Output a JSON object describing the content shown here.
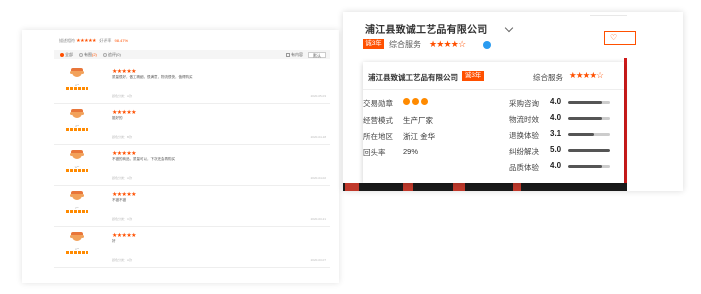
{
  "reviews_panel": {
    "summary_label": "描述相符",
    "summary_stars": "★★★★★",
    "good_rate_label": "好评率",
    "good_rate": "98.47%",
    "filters": {
      "all": "全部",
      "with_pics": "有图",
      "with_pics_count": "(2)",
      "append": "追评",
      "append_count": "(0)",
      "show_content": "有内容",
      "sort": "默认"
    },
    "items": [
      {
        "stars": "★★★★★",
        "user": "a**",
        "text": "质量很好，做工精细，很满意，物流很快，值得购买",
        "meta": "颜色分类：A款",
        "date": "2020-05-03"
      },
      {
        "stars": "★★★★★",
        "user": "d**",
        "text": "挺好的",
        "meta": "颜色分类：B款",
        "date": "2020-04-18"
      },
      {
        "stars": "★★★★★",
        "user": "w**",
        "text": "不错的商品，质量可以，下次还会再购买",
        "meta": "颜色分类：A款",
        "date": "2020-04-02"
      },
      {
        "stars": "★★★★★",
        "user": "t**",
        "text": "不错不错",
        "meta": "颜色分类：C款",
        "date": "2020-03-21"
      },
      {
        "stars": "★★★★★",
        "user": "s**",
        "text": "好",
        "meta": "颜色分类：A款",
        "date": "2020-03-07"
      }
    ]
  },
  "shop": {
    "name": "浦江县致诚工艺品有限公司",
    "year_badge": "诚3年",
    "rating_label": "综合服务",
    "rating_stars": "★★★★☆",
    "fav_icon": "heart-icon",
    "popup": {
      "title": "浦江县致诚工艺品有限公司",
      "year_badge": "诚3年",
      "rating_label": "综合服务",
      "rating_stars": "★★★★☆",
      "info": [
        {
          "label": "交易勋章",
          "value": ""
        },
        {
          "label": "经营模式",
          "value": "生产厂家"
        },
        {
          "label": "所在地区",
          "value": "浙江 金华"
        },
        {
          "label": "回头率",
          "value": "29%"
        }
      ],
      "metrics": [
        {
          "label": "采购咨询",
          "value": "4.0",
          "fill": 0.8
        },
        {
          "label": "物流时效",
          "value": "4.0",
          "fill": 0.8
        },
        {
          "label": "退换体验",
          "value": "3.1",
          "fill": 0.62
        },
        {
          "label": "纠纷解决",
          "value": "5.0",
          "fill": 1.0
        },
        {
          "label": "品质体验",
          "value": "4.0",
          "fill": 0.8
        }
      ]
    }
  },
  "colors": {
    "accent": "#ff5000",
    "blue": "#2a9bf0",
    "red": "#d01b1b"
  }
}
